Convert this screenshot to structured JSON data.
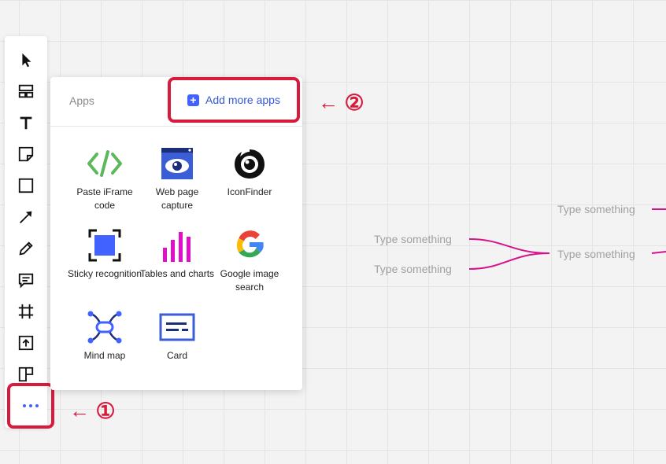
{
  "toolbar": {
    "tools": [
      {
        "name": "select-cursor-icon"
      },
      {
        "name": "templates-icon"
      },
      {
        "name": "text-tool-icon"
      },
      {
        "name": "sticky-note-icon"
      },
      {
        "name": "shape-icon"
      },
      {
        "name": "arrow-line-icon"
      },
      {
        "name": "pen-icon"
      },
      {
        "name": "comment-icon"
      },
      {
        "name": "frame-icon"
      },
      {
        "name": "upload-icon"
      },
      {
        "name": "kanban-icon"
      }
    ],
    "more_icon": "more-dots-icon",
    "accent": "#4262ff"
  },
  "apps_panel": {
    "title": "Apps",
    "add_more_label": "Add more apps",
    "items": [
      {
        "label": "Paste iFrame code",
        "icon": "code-brackets-icon"
      },
      {
        "label": "Web page capture",
        "icon": "web-capture-eye-icon"
      },
      {
        "label": "IconFinder",
        "icon": "iconfinder-logo-icon"
      },
      {
        "label": "Sticky recognition",
        "icon": "sticky-recognition-icon"
      },
      {
        "label": "Tables and charts",
        "icon": "bar-chart-icon"
      },
      {
        "label": "Google image search",
        "icon": "google-logo-icon"
      },
      {
        "label": "Mind map",
        "icon": "mind-map-icon"
      },
      {
        "label": "Card",
        "icon": "card-icon"
      }
    ]
  },
  "callouts": {
    "step1": {
      "arrow": "←",
      "number": "①"
    },
    "step2": {
      "arrow": "←",
      "number": "②"
    },
    "color": "#d81b3c"
  },
  "mind_map": {
    "nodes": [
      "Type something",
      "Type something",
      "Type something",
      "Type something"
    ],
    "link_color": "#d6128c"
  }
}
